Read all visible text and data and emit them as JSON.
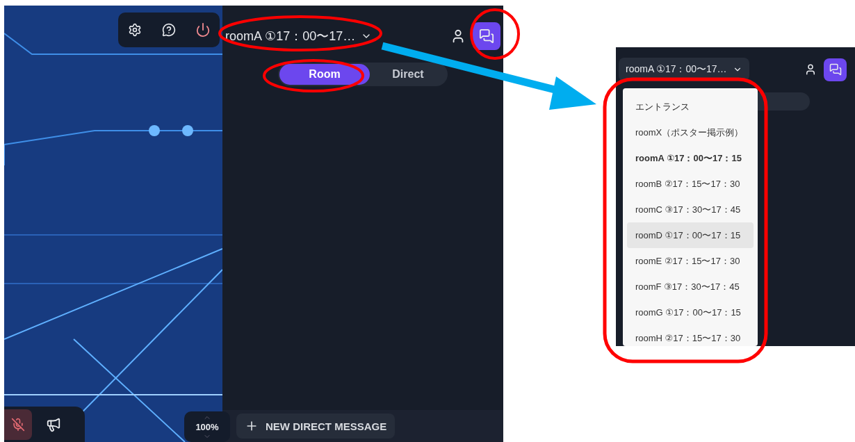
{
  "app_screen": {
    "microphone": {
      "muted": true
    },
    "zoom": {
      "value": "100%"
    },
    "room_select": {
      "value": "roomA ①17：00〜17…"
    },
    "chat_button": {
      "active": true
    },
    "tabs": [
      {
        "label": "Room",
        "selected": true
      },
      {
        "label": "Direct",
        "selected": false
      }
    ],
    "new_direct_message_button": "NEW DIRECT MESSAGE"
  },
  "zoomed_screen": {
    "room_select": {
      "value": "roomA ①17：00〜17…"
    },
    "chat_button": {
      "active": true
    },
    "room_menu": [
      {
        "label": "エントランス",
        "selected": false,
        "highlighted": false
      },
      {
        "label": "roomX（ポスター掲示例）",
        "selected": false,
        "highlighted": false
      },
      {
        "label": "roomA ①17：00〜17：15",
        "selected": true,
        "highlighted": false
      },
      {
        "label": "roomB ②17：15〜17：30",
        "selected": false,
        "highlighted": false
      },
      {
        "label": "roomC ③17：30〜17：45",
        "selected": false,
        "highlighted": false
      },
      {
        "label": "roomD ①17：00〜17：15",
        "selected": false,
        "highlighted": true
      },
      {
        "label": "roomE ②17：15〜17：30",
        "selected": false,
        "highlighted": false
      },
      {
        "label": "roomF ③17：30〜17：45",
        "selected": false,
        "highlighted": false
      },
      {
        "label": "roomG ①17：00〜17：15",
        "selected": false,
        "highlighted": false
      },
      {
        "label": "roomH ②17：15〜17：30",
        "selected": false,
        "highlighted": false
      }
    ]
  }
}
